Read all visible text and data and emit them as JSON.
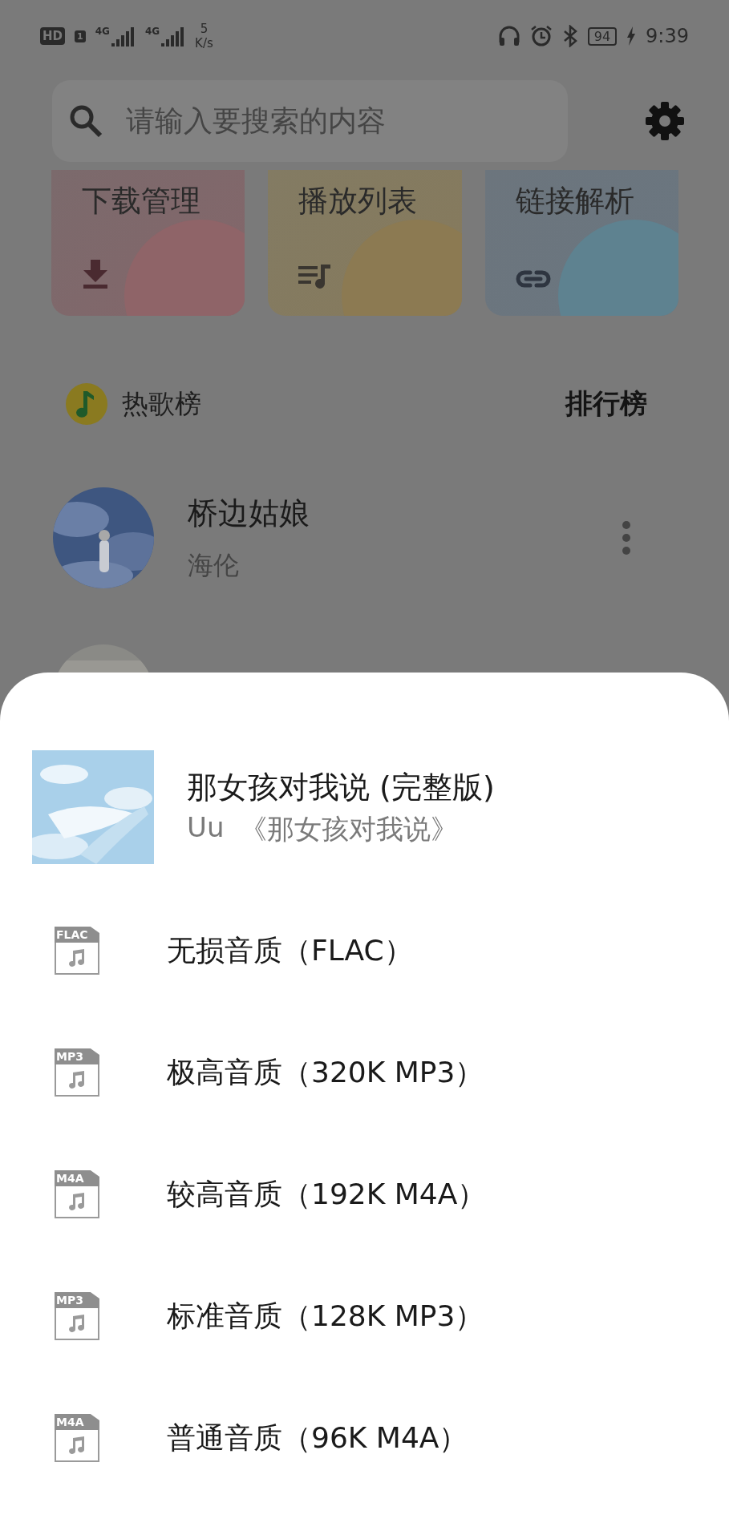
{
  "status_bar": {
    "hd": "HD",
    "sim": "1",
    "signals": [
      "4G",
      "4G"
    ],
    "speed_value": "5",
    "speed_unit": "K/s",
    "battery": "94",
    "time": "9:39"
  },
  "search": {
    "placeholder": "请输入要搜索的内容"
  },
  "shortcuts": [
    {
      "label": "下载管理",
      "kind": "download"
    },
    {
      "label": "播放列表",
      "kind": "playlist"
    },
    {
      "label": "链接解析",
      "kind": "link"
    }
  ],
  "chart_header": {
    "title": "热歌榜",
    "link": "排行榜"
  },
  "songs": [
    {
      "title": "桥边姑娘",
      "artist": "海伦"
    }
  ],
  "sheet": {
    "title": "那女孩对我说 (完整版)",
    "artist": "Uu",
    "album": "《那女孩对我说》",
    "options": [
      {
        "format": "FLAC",
        "label": "无损音质（FLAC）"
      },
      {
        "format": "MP3",
        "label": "极高音质（320K MP3）"
      },
      {
        "format": "M4A",
        "label": "较高音质（192K M4A）"
      },
      {
        "format": "MP3",
        "label": "标准音质（128K MP3）"
      },
      {
        "format": "M4A",
        "label": "普通音质（96K M4A）"
      }
    ]
  }
}
